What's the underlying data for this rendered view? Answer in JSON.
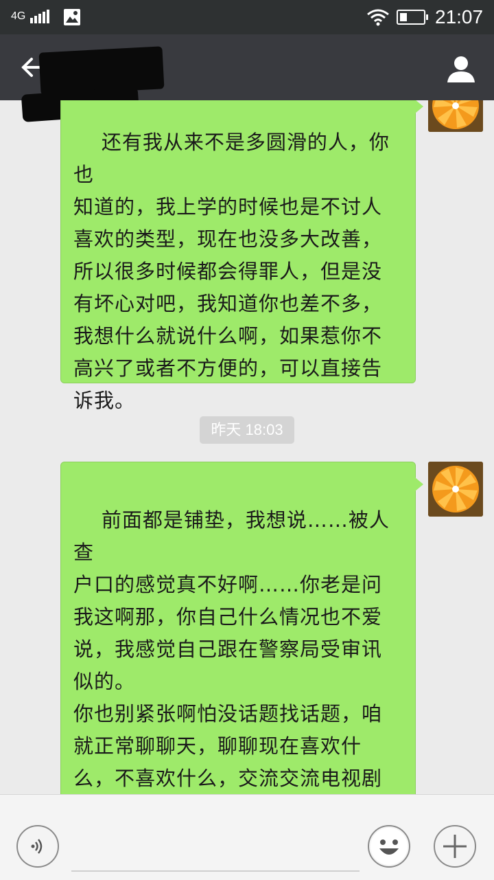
{
  "status_bar": {
    "network": "4G",
    "time": "21:07",
    "icons": [
      "signal-icon",
      "gallery-icon",
      "wifi-icon",
      "battery-icon"
    ]
  },
  "title_bar": {
    "contact_name": "",
    "icons": [
      "back-arrow-icon",
      "profile-icon"
    ]
  },
  "messages": [
    {
      "sender": "self",
      "text": "还有我从来不是多圆滑的人，你也\n知道的，我上学的时候也是不讨人\n喜欢的类型，现在也没多大改善，\n所以很多时候都会得罪人，但是没\n有坏心对吧，我知道你也差不多，\n我想什么就说什么啊，如果惹你不\n高兴了或者不方便的，可以直接告\n诉我。"
    },
    {
      "sender": "self",
      "text": "前面都是铺垫，我想说……被人查\n户口的感觉真不好啊……你老是问\n我这啊那，你自己什么情况也不爱\n说，我感觉自己跟在警察局受审讯\n似的。\n你也别紧张啊怕没话题找话题，咱\n就正常聊聊天，聊聊现在喜欢什\n么，不喜欢什么，交流交流电视剧\n小说，我记得你上学的时候喜欢看\n闲书啊，我要跟你一起看你还不愿\n意。"
    }
  ],
  "timestamp": "昨天 18:03",
  "input_bar": {
    "text_value": "",
    "icons": [
      "voice-icon",
      "emoji-icon",
      "plus-icon"
    ]
  },
  "colors": {
    "status_bar_bg": "#2e3132",
    "title_bar_bg": "#393a3f",
    "chat_bg": "#ebebeb",
    "bubble_green": "#9eea6a"
  }
}
